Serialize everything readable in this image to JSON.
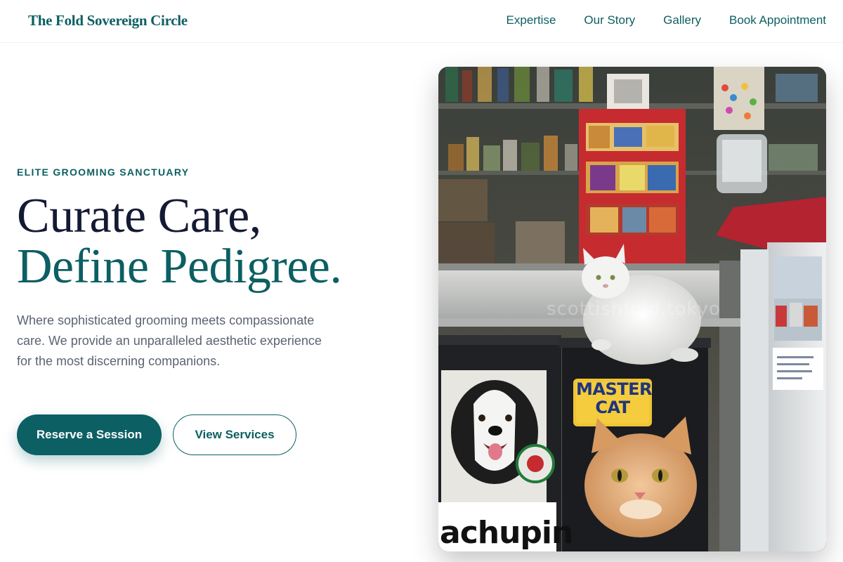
{
  "header": {
    "brand": "The Fold Sovereign Circle",
    "nav": [
      {
        "label": "Expertise"
      },
      {
        "label": "Our Story"
      },
      {
        "label": "Gallery"
      },
      {
        "label": "Book Appointment"
      }
    ]
  },
  "hero": {
    "eyebrow": "ELITE GROOMING SANCTUARY",
    "headline_line1": "Curate Care,",
    "headline_line2": "Define Pedigree.",
    "lead": "Where sophisticated grooming meets compassionate care. We provide an unparalleled aesthetic experience for the most discerning companions.",
    "primary_cta": "Reserve a Session",
    "secondary_cta": "View Services"
  },
  "image": {
    "watermark": "scottishfold.tokyo",
    "bag_brand": "MASTER CAT",
    "bag_left_text": "achupin"
  },
  "colors": {
    "accent": "#0c5f63",
    "headline_dark": "#141a33",
    "body_text": "#5b6472"
  }
}
